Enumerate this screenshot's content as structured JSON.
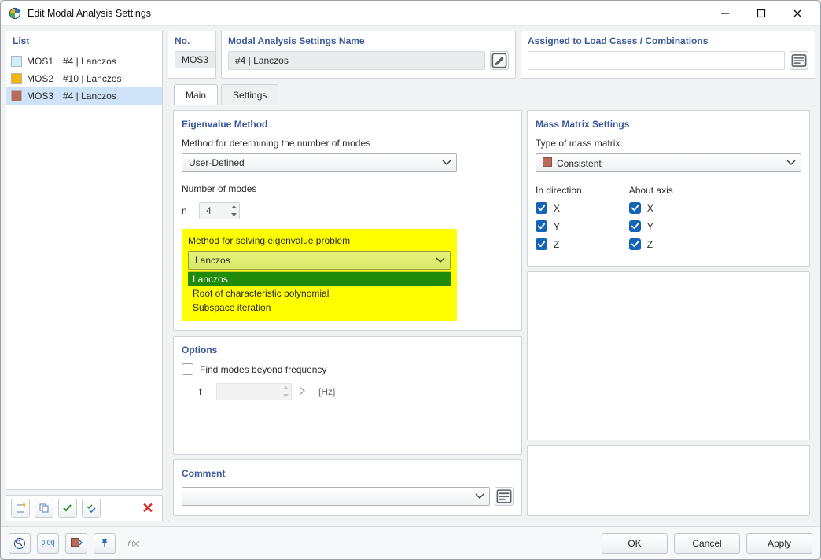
{
  "window": {
    "title": "Edit Modal Analysis Settings"
  },
  "list": {
    "title": "List",
    "items": [
      {
        "code": "MOS1",
        "label": "#4 | Lanczos",
        "color": "#cfeff8"
      },
      {
        "code": "MOS2",
        "label": "#10 | Lanczos",
        "color": "#f2b705"
      },
      {
        "code": "MOS3",
        "label": "#4 | Lanczos",
        "color": "#b66b5d"
      }
    ],
    "selected_index": 2
  },
  "header": {
    "no_title": "No.",
    "no_value": "MOS3",
    "name_title": "Modal Analysis Settings Name",
    "name_value": "#4 | Lanczos",
    "assign_title": "Assigned to Load Cases / Combinations"
  },
  "tabs": {
    "items": [
      "Main",
      "Settings"
    ],
    "active_index": 0
  },
  "eigen": {
    "group_title": "Eigenvalue Method",
    "method_label": "Method for determining the number of modes",
    "method_value": "User-Defined",
    "n_modes_label": "Number of modes",
    "n_symbol": "n",
    "n_value": "4",
    "solver_label": "Method for solving eigenvalue problem",
    "solver_value": "Lanczos",
    "solver_options": [
      "Lanczos",
      "Root of characteristic polynomial",
      "Subspace iteration"
    ],
    "solver_selected_index": 0
  },
  "options": {
    "group_title": "Options",
    "find_beyond_label": "Find modes beyond frequency",
    "f_symbol": "f",
    "f_unit": "[Hz]"
  },
  "mass": {
    "group_title": "Mass Matrix Settings",
    "type_label": "Type of mass matrix",
    "type_value": "Consistent",
    "in_direction_label": "In direction",
    "about_axis_label": "About axis",
    "axes": [
      "X",
      "Y",
      "Z"
    ]
  },
  "comment": {
    "group_title": "Comment"
  },
  "buttons": {
    "ok": "OK",
    "cancel": "Cancel",
    "apply": "Apply"
  },
  "status_text": "0,00"
}
